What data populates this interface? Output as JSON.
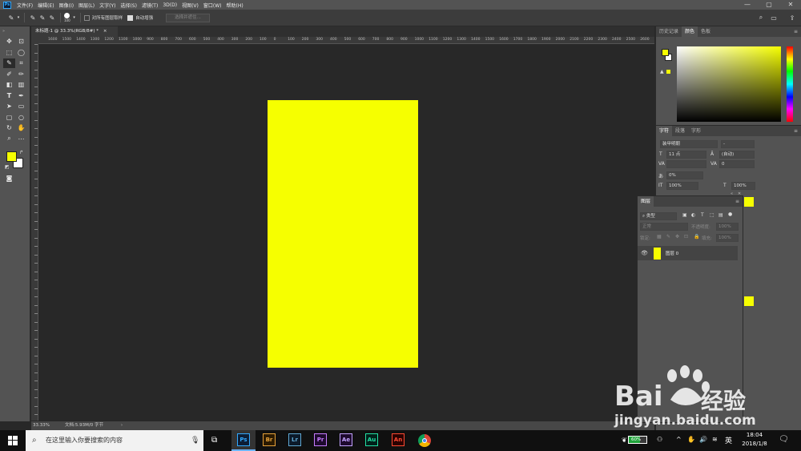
{
  "menubar": {
    "logo": "Ps",
    "items": [
      "文件(F)",
      "编辑(E)",
      "图像(I)",
      "图层(L)",
      "文字(Y)",
      "选择(S)",
      "滤镜(T)",
      "3D(D)",
      "视图(V)",
      "窗口(W)",
      "帮助(H)"
    ],
    "win_min": "—",
    "win_max": "▢",
    "win_close": "✕"
  },
  "options": {
    "brush_size": "100",
    "sample_all_layers": "对所有图层取样",
    "auto_enhance": "自动增强",
    "select_subject": "选择并遮住..."
  },
  "document": {
    "tab_title": "未标题-1 @ 33.3%(RGB/8#) *",
    "tab_close": "×",
    "zoom": "33.33%",
    "doc_info": "文档:5.93M/0 字节",
    "canvas_color": "#f6ff00"
  },
  "ruler": {
    "labels": [
      "1600",
      "1500",
      "1400",
      "1300",
      "1200",
      "1100",
      "1000",
      "900",
      "800",
      "700",
      "600",
      "500",
      "400",
      "300",
      "200",
      "100",
      "0",
      "100",
      "200",
      "300",
      "400",
      "500",
      "600",
      "700",
      "800",
      "900",
      "1000",
      "1100",
      "1200",
      "1300",
      "1400",
      "1500",
      "1600",
      "1700",
      "1800",
      "1900",
      "2000",
      "2100",
      "2200",
      "2300",
      "2400",
      "2500",
      "2600",
      "2700"
    ]
  },
  "colors_panel": {
    "tabs": [
      "历史记录",
      "颜色",
      "色板"
    ],
    "active_tab": "颜色",
    "foreground": "#f6ff00",
    "background": "#ffffff"
  },
  "character_panel": {
    "tabs": [
      "字符",
      "段落",
      "字形"
    ],
    "font_family": "装甲明朝",
    "font_style": "-",
    "font_size": "11 点",
    "leading": "(自动)",
    "kerning": "",
    "tracking": "0",
    "scale": "0%",
    "vscale": "100%",
    "hscale": "100%"
  },
  "layers_panel": {
    "title": "图层",
    "filter_kind": "类型",
    "blend_mode": "正常",
    "opacity_label": "不透明度:",
    "opacity_value": "100%",
    "lock_label": "锁定:",
    "fill_label": "填充:",
    "fill_value": "100%",
    "layer_name": "图层 0",
    "layer_thumb_color": "#f6ff00"
  },
  "taskbar": {
    "search_placeholder": "在这里输入你要搜索的内容",
    "apps": [
      "Ps",
      "Br",
      "Lr",
      "Pr",
      "Ae",
      "Au",
      "An"
    ],
    "battery": "60%",
    "ime": "英",
    "time": "18:04",
    "date": "2018/1/8"
  },
  "watermark": {
    "brand_a": "Bai",
    "brand_b": "经验",
    "url": "jingyan.baidu.com"
  }
}
